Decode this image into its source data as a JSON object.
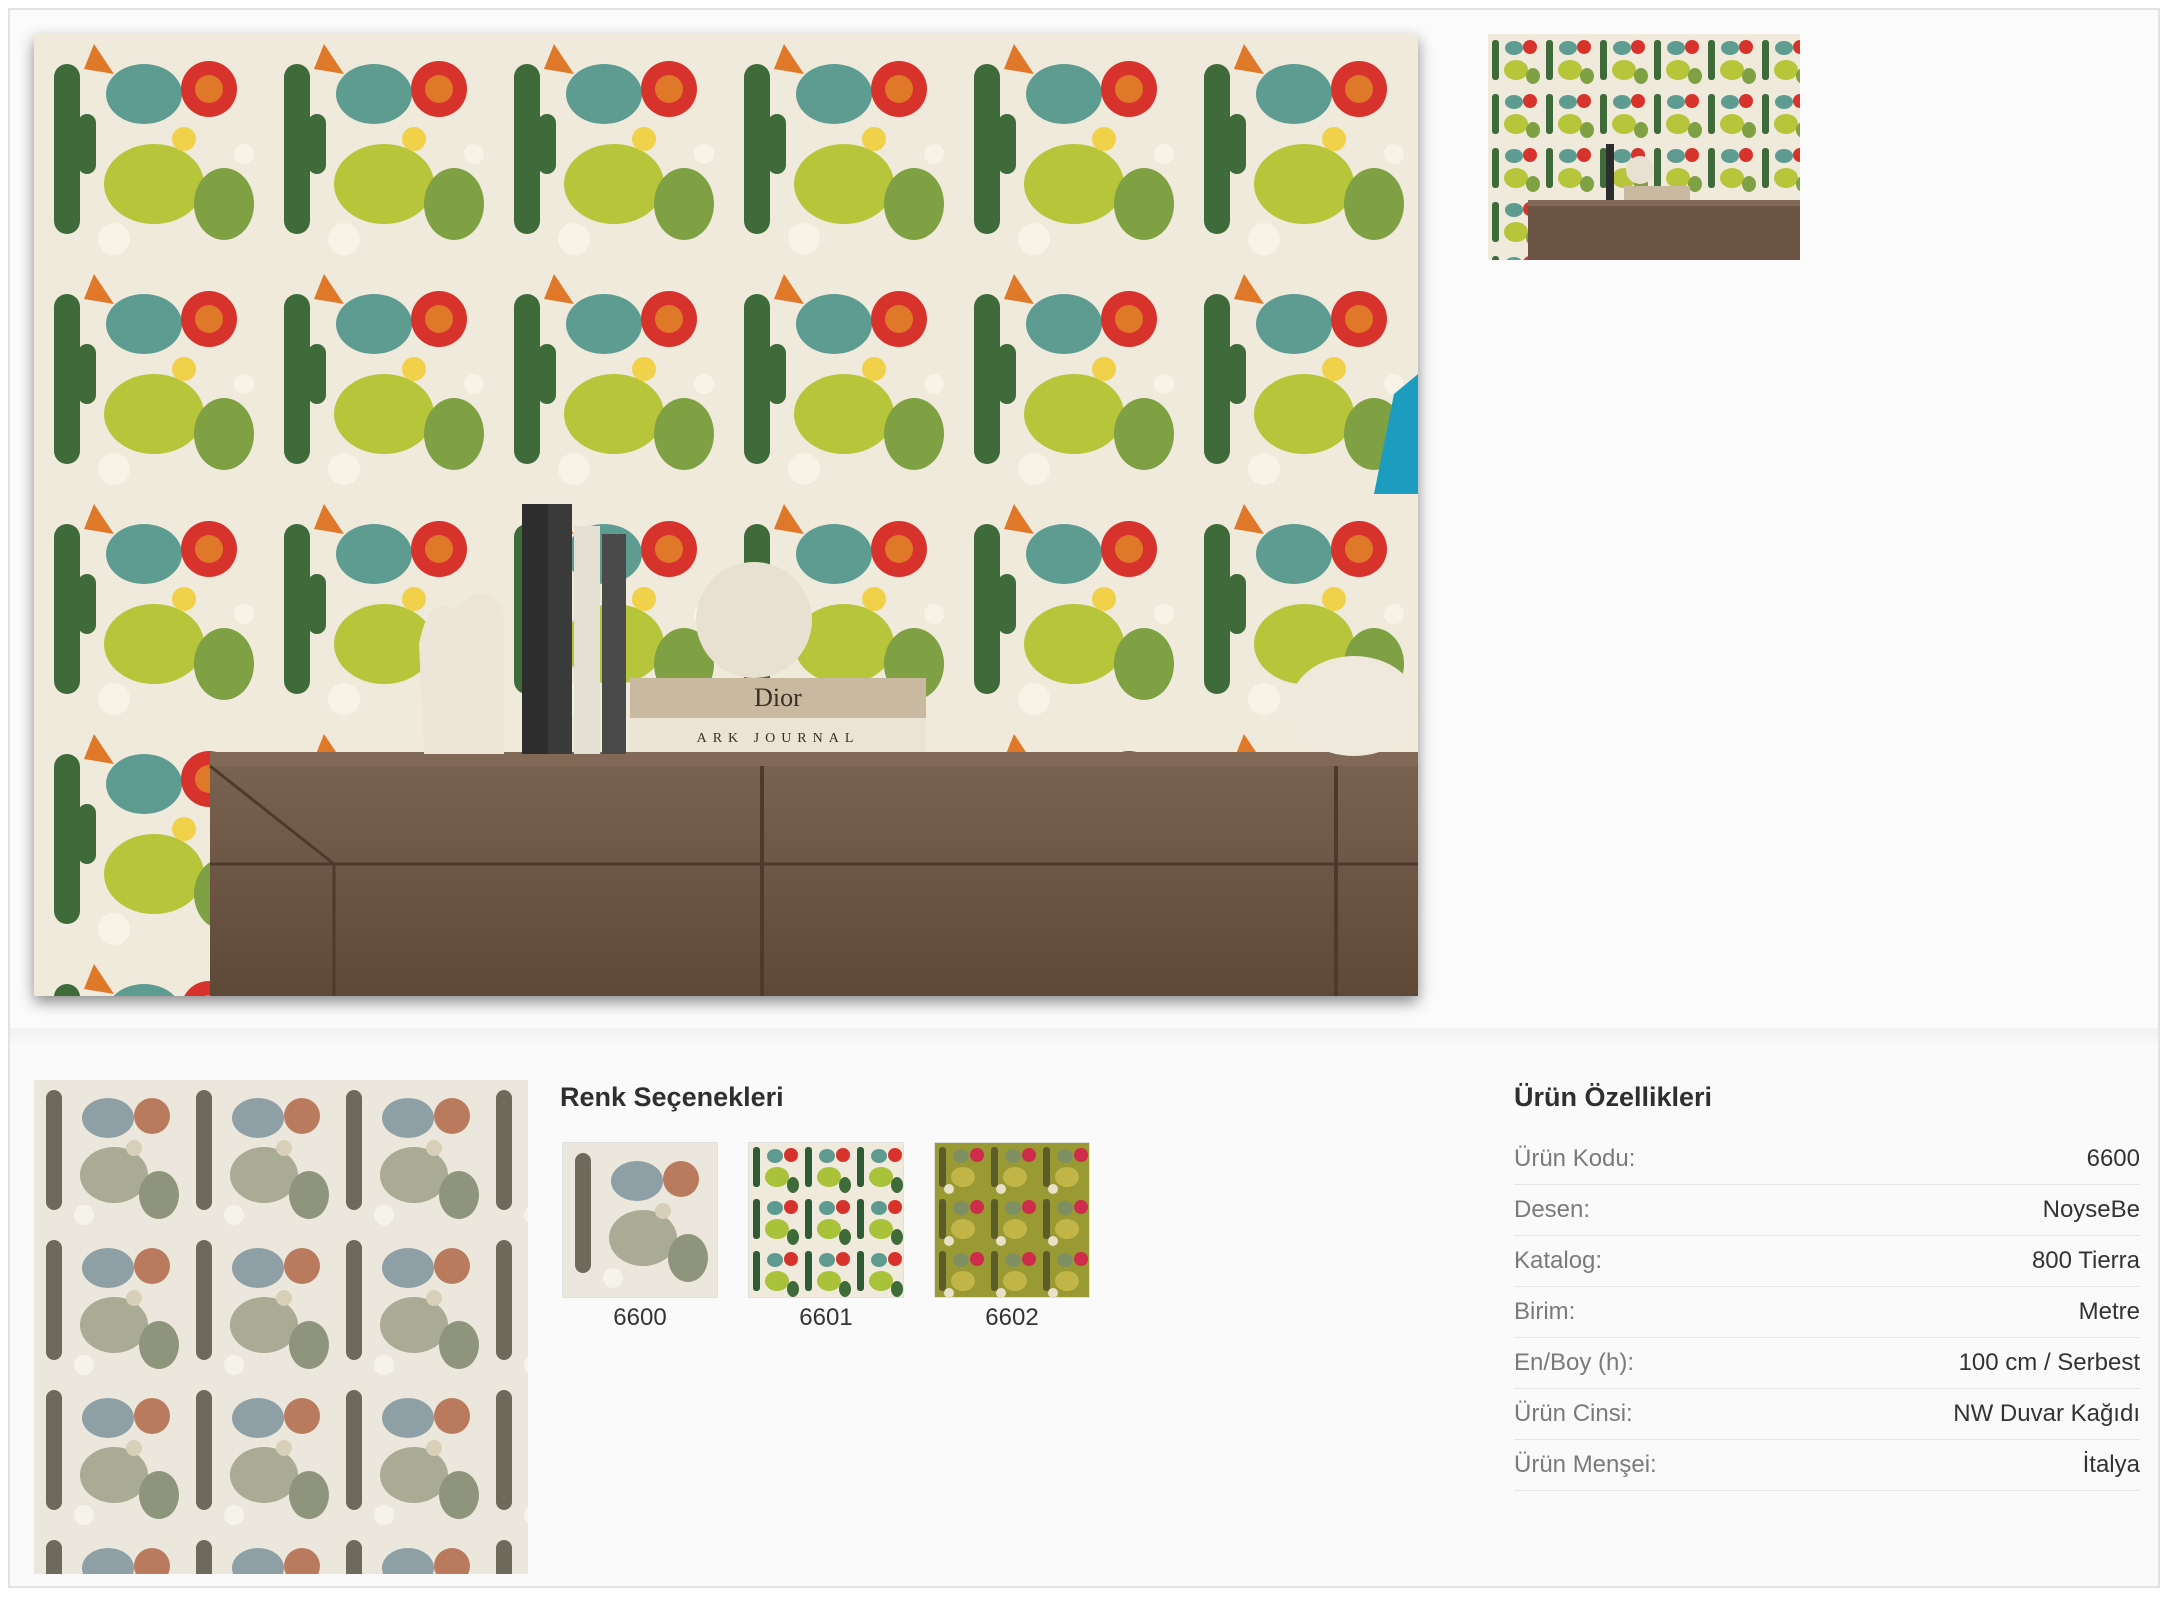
{
  "colors_section": {
    "title": "Renk Seçenekleri",
    "options": [
      {
        "code": "6600",
        "tone": "muted"
      },
      {
        "code": "6601",
        "tone": "vivid"
      },
      {
        "code": "6602",
        "tone": "olive"
      }
    ]
  },
  "props_section": {
    "title": "Ürün Özellikleri",
    "rows": [
      {
        "label": "Ürün Kodu:",
        "value": "6600"
      },
      {
        "label": "Desen:",
        "value": "NoyseBe"
      },
      {
        "label": "Katalog:",
        "value": "800 Tierra"
      },
      {
        "label": "Birim:",
        "value": "Metre"
      },
      {
        "label": "En/Boy (h):",
        "value": "100 cm / Serbest"
      },
      {
        "label": "Ürün Cinsi:",
        "value": "NW Duvar Kağıdı"
      },
      {
        "label": "Ürün Menşei:",
        "value": "İtalya"
      }
    ]
  },
  "room_image": {
    "book_title": "Dior",
    "book_subtitle": "ARK JOURNAL"
  },
  "colors": {
    "background": "#fafafa",
    "wallpaper_bg": "#efeadb",
    "cactus_dark": "#3f6b3a",
    "cactus_light": "#b7c53a",
    "flower_red": "#d8322c",
    "flower_orange": "#e0782a",
    "teal": "#5e9c92",
    "wood": "#6b5443"
  }
}
